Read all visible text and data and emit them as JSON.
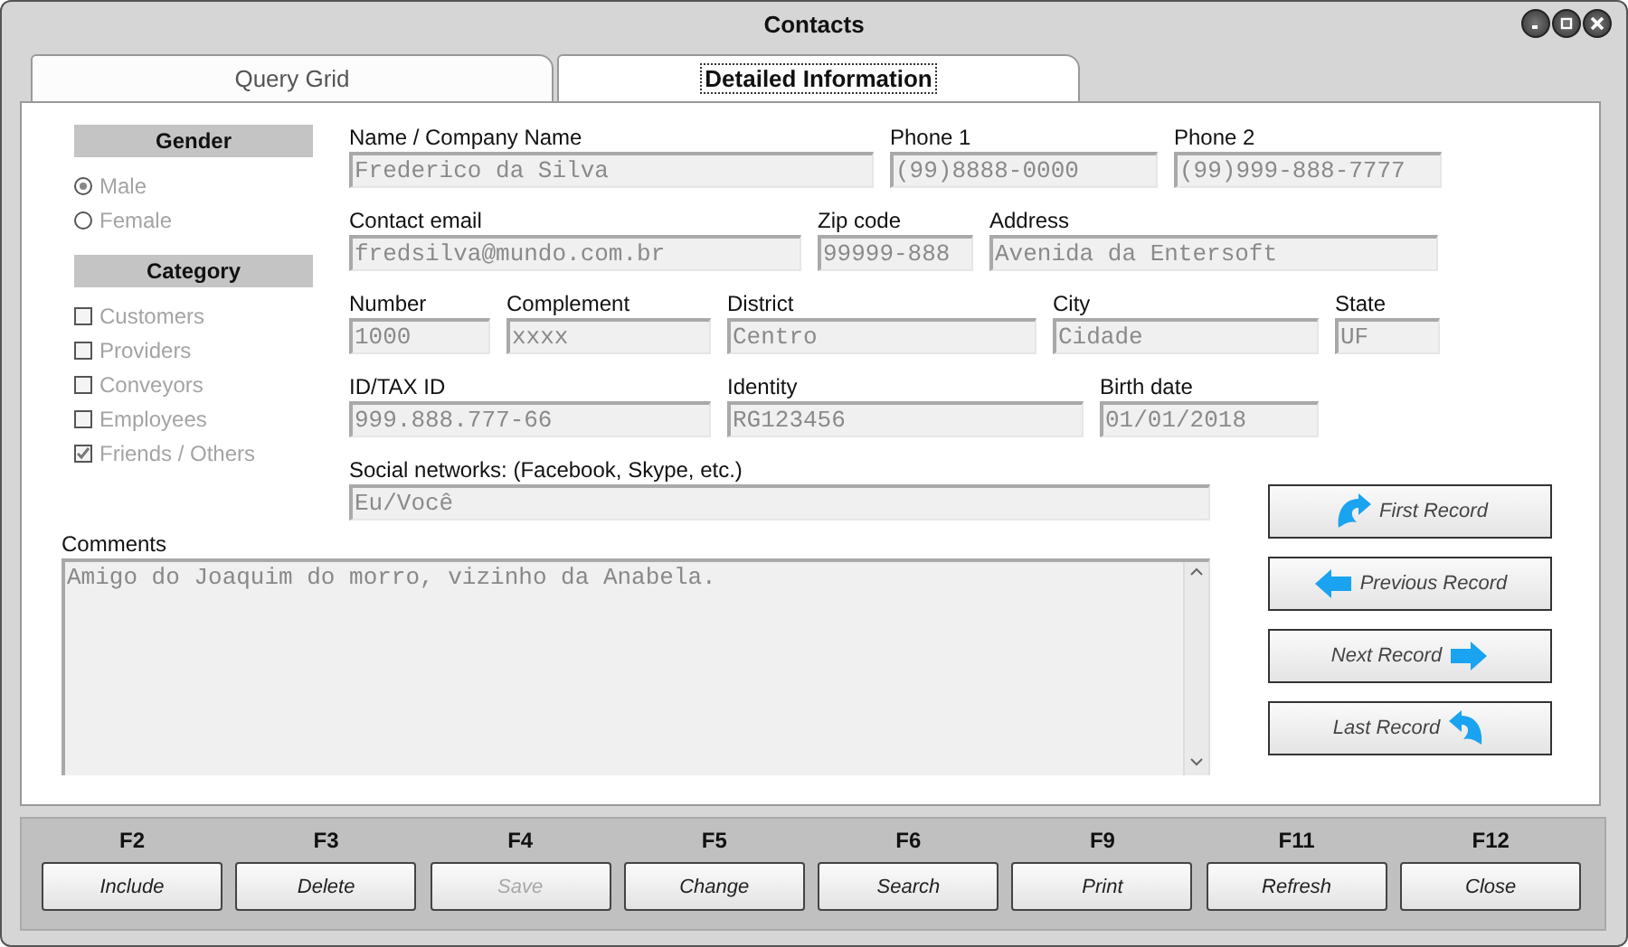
{
  "window": {
    "title": "Contacts"
  },
  "tabs": [
    {
      "label": "Query Grid",
      "selected": false
    },
    {
      "label": "Detailed Information",
      "selected": true
    }
  ],
  "gender": {
    "title": "Gender",
    "options": [
      {
        "label": "Male",
        "selected": true
      },
      {
        "label": "Female",
        "selected": false
      }
    ]
  },
  "category": {
    "title": "Category",
    "options": [
      {
        "label": "Customers",
        "checked": false
      },
      {
        "label": "Providers",
        "checked": false
      },
      {
        "label": "Conveyors",
        "checked": false
      },
      {
        "label": "Employees",
        "checked": false
      },
      {
        "label": "Friends / Others",
        "checked": true
      }
    ]
  },
  "field_rows": [
    [
      {
        "label": "Name / Company Name",
        "value": "Frederico da Silva"
      },
      {
        "label": "Phone 1",
        "value": "(99)8888-0000"
      },
      {
        "label": "Phone 2",
        "value": "(99)999-888-7777"
      }
    ],
    [
      {
        "label": "Contact email",
        "value": "fredsilva@mundo.com.br"
      },
      {
        "label": "Zip code",
        "value": "99999-888"
      },
      {
        "label": "Address",
        "value": "Avenida da Entersoft"
      }
    ],
    [
      {
        "label": "Number",
        "value": "1000"
      },
      {
        "label": "Complement",
        "value": "xxxx"
      },
      {
        "label": "District",
        "value": "Centro"
      },
      {
        "label": "City",
        "value": "Cidade"
      },
      {
        "label": "State",
        "value": "UF"
      }
    ],
    [
      {
        "label": "ID/TAX ID",
        "value": "999.888.777-66"
      },
      {
        "label": "Identity",
        "value": "RG123456"
      },
      {
        "label": "Birth date",
        "value": "01/01/2018"
      }
    ]
  ],
  "social": {
    "label": "Social networks: (Facebook, Skype, etc.)",
    "value": "Eu/Você"
  },
  "comments": {
    "label": "Comments",
    "value": "Amigo do Joaquim do morro, vizinho da Anabela."
  },
  "nav_buttons": [
    {
      "kind": "first",
      "label": "First Record"
    },
    {
      "kind": "previous",
      "label": "Previous Record"
    },
    {
      "kind": "next",
      "label": "Next Record"
    },
    {
      "kind": "last",
      "label": "Last Record"
    }
  ],
  "function_keys": [
    {
      "key": "F2",
      "label": "Include",
      "disabled": false
    },
    {
      "key": "F3",
      "label": "Delete",
      "disabled": false
    },
    {
      "key": "F4",
      "label": "Save",
      "disabled": true
    },
    {
      "key": "F5",
      "label": "Change",
      "disabled": false
    },
    {
      "key": "F6",
      "label": "Search",
      "disabled": false
    },
    {
      "key": "F9",
      "label": "Print",
      "disabled": false
    },
    {
      "key": "F11",
      "label": "Refresh",
      "disabled": false
    },
    {
      "key": "F12",
      "label": "Close",
      "disabled": false
    }
  ]
}
